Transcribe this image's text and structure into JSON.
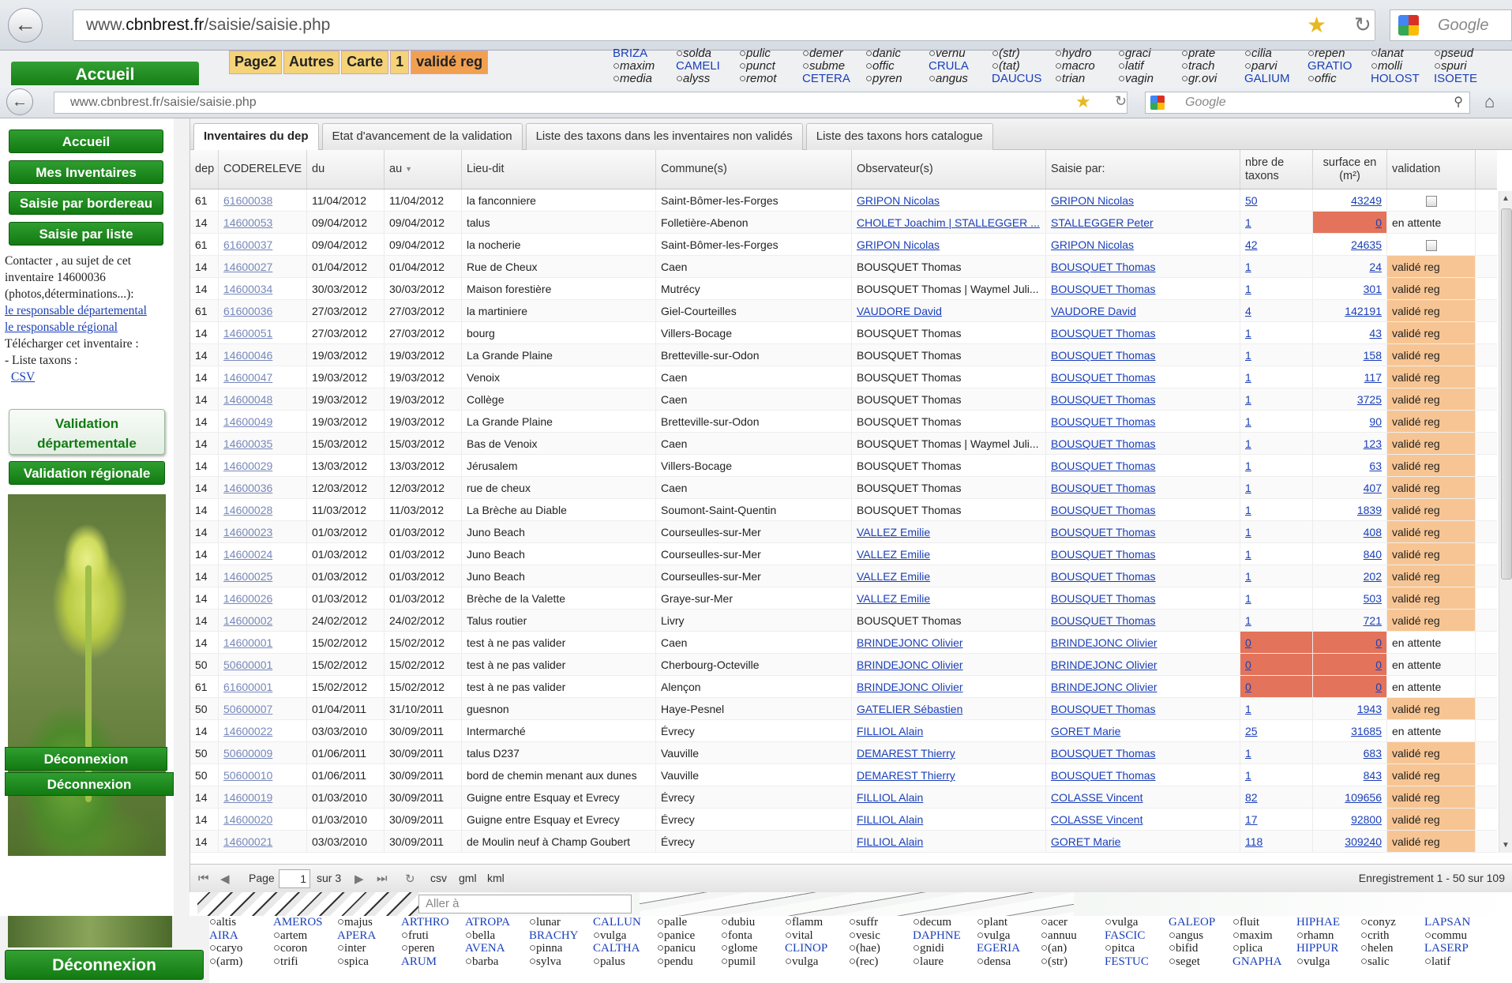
{
  "outer_browser": {
    "url_prefix": "www.",
    "url_domain": "cbnbrest.fr",
    "url_path": "/saisie/saisie.php",
    "search_placeholder": "Google",
    "accueil_label": "Accueil",
    "tabs": [
      "Page2",
      "Autres",
      "Carte",
      "1",
      "validé reg"
    ],
    "taxa_rows": [
      [
        "BRIZA",
        "○solda",
        "○pulic",
        "○demer",
        "○danic",
        "○vernu",
        "○(str)",
        "○hydro",
        "○graci",
        "○prate",
        "○cilia",
        "○repen",
        "○lanat",
        "○pseud"
      ],
      [
        "○maxim",
        "CAMELI",
        "○punct",
        "○subme",
        "○offic",
        "CRULA",
        "○(tat)",
        "○macro",
        "○latif",
        "○trach",
        "○parvi",
        "GRATIO",
        "○molli",
        "○spuri"
      ],
      [
        "○media",
        "○alyss",
        "○remot",
        "CETERA",
        "○pyren",
        "○angus",
        "DAUCUS",
        "○trian",
        "○vagin",
        "○gr.ovi",
        "GALIUM",
        "○offic",
        "HOLOST",
        "ISOETE"
      ]
    ]
  },
  "inner_browser": {
    "url": "www.cbnbrest.fr/saisie/saisie.php",
    "search_placeholder": "Google"
  },
  "sidebar": {
    "buttons": [
      "Accueil",
      "Mes Inventaires",
      "Saisie par bordereau",
      "Saisie par liste"
    ],
    "contact_text": "Contacter , au sujet de cet inventaire 14600036 (photos,déterminations...):",
    "link_dep": "le responsable départemental",
    "link_reg": "le responsable régional",
    "download_text": "Télécharger cet inventaire :",
    "taxa_list_text": "- Liste taxons :",
    "csv_link": "CSV",
    "validation_dep": "Validation départementale",
    "validation_reg": "Validation régionale",
    "logout": "Déconnexion"
  },
  "tabs": [
    "Inventaires du dep",
    "Etat d'avancement de la validation",
    "Liste des taxons dans les inventaires non validés",
    "Liste des taxons hors catalogue"
  ],
  "grid": {
    "headers": {
      "dep": "dep",
      "code": "CODERELEVE",
      "du": "du",
      "au": "au",
      "lieu": "Lieu-dit",
      "commune": "Commune(s)",
      "obs": "Observateur(s)",
      "saisie": "Saisie par:",
      "nb": "nbre de taxons",
      "surf": "surface en (m²)",
      "valid": "validation"
    },
    "rows": [
      {
        "dep": "61",
        "code": "61600038",
        "du": "11/04/2012",
        "au": "11/04/2012",
        "lieu": "la fanconniere",
        "commune": "Saint-Bômer-les-Forges",
        "obs": "GRIPON Nicolas",
        "obs_link": true,
        "saisie": "GRIPON Nicolas",
        "nb": "50",
        "surf": "43249",
        "valid": "",
        "state": "check"
      },
      {
        "dep": "14",
        "code": "14600053",
        "du": "09/04/2012",
        "au": "09/04/2012",
        "lieu": "talus",
        "commune": "Folletière-Abenon",
        "obs": "CHOLET Joachim | STALLEGGER ...",
        "obs_link": true,
        "saisie": "STALLEGGER Peter",
        "nb": "1",
        "surf": "0",
        "valid": "en attente",
        "state": "wait-surf"
      },
      {
        "dep": "61",
        "code": "61600037",
        "du": "09/04/2012",
        "au": "09/04/2012",
        "lieu": "la nocherie",
        "commune": "Saint-Bômer-les-Forges",
        "obs": "GRIPON Nicolas",
        "obs_link": true,
        "saisie": "GRIPON Nicolas",
        "nb": "42",
        "surf": "24635",
        "valid": "",
        "state": "check"
      },
      {
        "dep": "14",
        "code": "14600027",
        "du": "01/04/2012",
        "au": "01/04/2012",
        "lieu": "Rue de Cheux",
        "commune": "Caen",
        "obs": "BOUSQUET Thomas",
        "obs_link": false,
        "saisie": "BOUSQUET Thomas",
        "nb": "1",
        "surf": "24",
        "valid": "validé reg",
        "state": "valid"
      },
      {
        "dep": "14",
        "code": "14600034",
        "du": "30/03/2012",
        "au": "30/03/2012",
        "lieu": "Maison forestière",
        "commune": "Mutrécy",
        "obs": "BOUSQUET Thomas | Waymel Juli...",
        "obs_link": false,
        "saisie": "BOUSQUET Thomas",
        "nb": "1",
        "surf": "301",
        "valid": "validé reg",
        "state": "valid"
      },
      {
        "dep": "61",
        "code": "61600036",
        "du": "27/03/2012",
        "au": "27/03/2012",
        "lieu": "la martiniere",
        "commune": "Giel-Courteilles",
        "obs": "VAUDORE David",
        "obs_link": true,
        "saisie": "VAUDORE David",
        "nb": "4",
        "surf": "142191",
        "valid": "validé reg",
        "state": "valid"
      },
      {
        "dep": "14",
        "code": "14600051",
        "du": "27/03/2012",
        "au": "27/03/2012",
        "lieu": "bourg",
        "commune": "Villers-Bocage",
        "obs": "BOUSQUET Thomas",
        "obs_link": false,
        "saisie": "BOUSQUET Thomas",
        "nb": "1",
        "surf": "43",
        "valid": "validé reg",
        "state": "valid"
      },
      {
        "dep": "14",
        "code": "14600046",
        "du": "19/03/2012",
        "au": "19/03/2012",
        "lieu": "La Grande Plaine",
        "commune": "Bretteville-sur-Odon",
        "obs": "BOUSQUET Thomas",
        "obs_link": false,
        "saisie": "BOUSQUET Thomas",
        "nb": "1",
        "surf": "158",
        "valid": "validé reg",
        "state": "valid"
      },
      {
        "dep": "14",
        "code": "14600047",
        "du": "19/03/2012",
        "au": "19/03/2012",
        "lieu": "Venoix",
        "commune": "Caen",
        "obs": "BOUSQUET Thomas",
        "obs_link": false,
        "saisie": "BOUSQUET Thomas",
        "nb": "1",
        "surf": "117",
        "valid": "validé reg",
        "state": "valid"
      },
      {
        "dep": "14",
        "code": "14600048",
        "du": "19/03/2012",
        "au": "19/03/2012",
        "lieu": "Collège",
        "commune": "Caen",
        "obs": "BOUSQUET Thomas",
        "obs_link": false,
        "saisie": "BOUSQUET Thomas",
        "nb": "1",
        "surf": "3725",
        "valid": "validé reg",
        "state": "valid"
      },
      {
        "dep": "14",
        "code": "14600049",
        "du": "19/03/2012",
        "au": "19/03/2012",
        "lieu": "La Grande Plaine",
        "commune": "Bretteville-sur-Odon",
        "obs": "BOUSQUET Thomas",
        "obs_link": false,
        "saisie": "BOUSQUET Thomas",
        "nb": "1",
        "surf": "90",
        "valid": "validé reg",
        "state": "valid"
      },
      {
        "dep": "14",
        "code": "14600035",
        "du": "15/03/2012",
        "au": "15/03/2012",
        "lieu": "Bas de Venoix",
        "commune": "Caen",
        "obs": "BOUSQUET Thomas | Waymel Juli...",
        "obs_link": false,
        "saisie": "BOUSQUET Thomas",
        "nb": "1",
        "surf": "123",
        "valid": "validé reg",
        "state": "valid"
      },
      {
        "dep": "14",
        "code": "14600029",
        "du": "13/03/2012",
        "au": "13/03/2012",
        "lieu": "Jérusalem",
        "commune": "Villers-Bocage",
        "obs": "BOUSQUET Thomas",
        "obs_link": false,
        "saisie": "BOUSQUET Thomas",
        "nb": "1",
        "surf": "63",
        "valid": "validé reg",
        "state": "valid"
      },
      {
        "dep": "14",
        "code": "14600036",
        "du": "12/03/2012",
        "au": "12/03/2012",
        "lieu": "rue de cheux",
        "commune": "Caen",
        "obs": "BOUSQUET Thomas",
        "obs_link": false,
        "saisie": "BOUSQUET Thomas",
        "nb": "1",
        "surf": "407",
        "valid": "validé reg",
        "state": "valid"
      },
      {
        "dep": "14",
        "code": "14600028",
        "du": "11/03/2012",
        "au": "11/03/2012",
        "lieu": "La Brèche au Diable",
        "commune": "Soumont-Saint-Quentin",
        "obs": "BOUSQUET Thomas",
        "obs_link": false,
        "saisie": "BOUSQUET Thomas",
        "nb": "1",
        "surf": "1839",
        "valid": "validé reg",
        "state": "valid"
      },
      {
        "dep": "14",
        "code": "14600023",
        "du": "01/03/2012",
        "au": "01/03/2012",
        "lieu": "Juno Beach",
        "commune": "Courseulles-sur-Mer",
        "obs": "VALLEZ Emilie",
        "obs_link": true,
        "saisie": "BOUSQUET Thomas",
        "nb": "1",
        "surf": "408",
        "valid": "validé reg",
        "state": "valid"
      },
      {
        "dep": "14",
        "code": "14600024",
        "du": "01/03/2012",
        "au": "01/03/2012",
        "lieu": "Juno Beach",
        "commune": "Courseulles-sur-Mer",
        "obs": "VALLEZ Emilie",
        "obs_link": true,
        "saisie": "BOUSQUET Thomas",
        "nb": "1",
        "surf": "840",
        "valid": "validé reg",
        "state": "valid"
      },
      {
        "dep": "14",
        "code": "14600025",
        "du": "01/03/2012",
        "au": "01/03/2012",
        "lieu": "Juno Beach",
        "commune": "Courseulles-sur-Mer",
        "obs": "VALLEZ Emilie",
        "obs_link": true,
        "saisie": "BOUSQUET Thomas",
        "nb": "1",
        "surf": "202",
        "valid": "validé reg",
        "state": "valid"
      },
      {
        "dep": "14",
        "code": "14600026",
        "du": "01/03/2012",
        "au": "01/03/2012",
        "lieu": "Brèche de la Valette",
        "commune": "Graye-sur-Mer",
        "obs": "VALLEZ Emilie",
        "obs_link": true,
        "saisie": "BOUSQUET Thomas",
        "nb": "1",
        "surf": "503",
        "valid": "validé reg",
        "state": "valid"
      },
      {
        "dep": "14",
        "code": "14600002",
        "du": "24/02/2012",
        "au": "24/02/2012",
        "lieu": "Talus routier",
        "commune": "Livry",
        "obs": "BOUSQUET Thomas",
        "obs_link": false,
        "saisie": "BOUSQUET Thomas",
        "nb": "1",
        "surf": "721",
        "valid": "validé reg",
        "state": "valid"
      },
      {
        "dep": "14",
        "code": "14600001",
        "du": "15/02/2012",
        "au": "15/02/2012",
        "lieu": "test à ne pas valider",
        "commune": "Caen",
        "obs": "BRINDEJONC Olivier",
        "obs_link": true,
        "saisie": "BRINDEJONC Olivier",
        "nb": "0",
        "surf": "0",
        "valid": "en attente",
        "state": "wait-both"
      },
      {
        "dep": "50",
        "code": "50600001",
        "du": "15/02/2012",
        "au": "15/02/2012",
        "lieu": "test à ne pas valider",
        "commune": "Cherbourg-Octeville",
        "obs": "BRINDEJONC Olivier",
        "obs_link": true,
        "saisie": "BRINDEJONC Olivier",
        "nb": "0",
        "surf": "0",
        "valid": "en attente",
        "state": "wait-both"
      },
      {
        "dep": "61",
        "code": "61600001",
        "du": "15/02/2012",
        "au": "15/02/2012",
        "lieu": "test à ne pas valider",
        "commune": "Alençon",
        "obs": "BRINDEJONC Olivier",
        "obs_link": true,
        "saisie": "BRINDEJONC Olivier",
        "nb": "0",
        "surf": "0",
        "valid": "en attente",
        "state": "wait-both"
      },
      {
        "dep": "50",
        "code": "50600007",
        "du": "01/04/2011",
        "au": "31/10/2011",
        "lieu": "guesnon",
        "commune": "Haye-Pesnel",
        "obs": "GATELIER Sébastien",
        "obs_link": true,
        "saisie": "BOUSQUET Thomas",
        "nb": "1",
        "surf": "1943",
        "valid": "validé reg",
        "state": "valid"
      },
      {
        "dep": "14",
        "code": "14600022",
        "du": "03/03/2010",
        "au": "30/09/2011",
        "lieu": "Intermarché",
        "commune": "Évrecy",
        "obs": "FILLIOL Alain",
        "obs_link": true,
        "saisie": "GORET Marie",
        "nb": "25",
        "surf": "31685",
        "valid": "en attente",
        "state": "plain"
      },
      {
        "dep": "50",
        "code": "50600009",
        "du": "01/06/2011",
        "au": "30/09/2011",
        "lieu": "talus D237",
        "commune": "Vauville",
        "obs": "DEMAREST Thierry",
        "obs_link": true,
        "saisie": "BOUSQUET Thomas",
        "nb": "1",
        "surf": "683",
        "valid": "validé reg",
        "state": "valid"
      },
      {
        "dep": "50",
        "code": "50600010",
        "du": "01/06/2011",
        "au": "30/09/2011",
        "lieu": "bord de chemin menant aux dunes",
        "commune": "Vauville",
        "obs": "DEMAREST Thierry",
        "obs_link": true,
        "saisie": "BOUSQUET Thomas",
        "nb": "1",
        "surf": "843",
        "valid": "validé reg",
        "state": "valid"
      },
      {
        "dep": "14",
        "code": "14600019",
        "du": "01/03/2010",
        "au": "30/09/2011",
        "lieu": "Guigne entre Esquay et Evrecy",
        "commune": "Évrecy",
        "obs": "FILLIOL Alain",
        "obs_link": true,
        "saisie": "COLASSE Vincent",
        "nb": "82",
        "surf": "109656",
        "valid": "validé reg",
        "state": "valid"
      },
      {
        "dep": "14",
        "code": "14600020",
        "du": "01/03/2010",
        "au": "30/09/2011",
        "lieu": "Guigne entre Esquay et Evrecy",
        "commune": "Évrecy",
        "obs": "FILLIOL Alain",
        "obs_link": true,
        "saisie": "COLASSE Vincent",
        "nb": "17",
        "surf": "92800",
        "valid": "validé reg",
        "state": "valid"
      },
      {
        "dep": "14",
        "code": "14600021",
        "du": "03/03/2010",
        "au": "30/09/2011",
        "lieu": "de Moulin neuf à Champ Goubert",
        "commune": "Évrecy",
        "obs": "FILLIOL Alain",
        "obs_link": true,
        "saisie": "GORET Marie",
        "nb": "118",
        "surf": "309240",
        "valid": "validé reg",
        "state": "valid"
      }
    ]
  },
  "pager": {
    "page_label": "Page",
    "page_value": "1",
    "of_label": "sur 3",
    "export_csv": "csv",
    "export_gml": "gml",
    "export_kml": "kml",
    "records": "Enregistrement 1 - 50 sur 109"
  },
  "ghost": {
    "aller_placeholder": "Aller à",
    "taxa_rows": [
      [
        "○altis",
        "AMEROS",
        "○majus",
        "ARTHRO",
        "ATROPA",
        "○lunar",
        "CALLUN",
        "○palle",
        "○dubiu",
        "○flamm",
        "○suffr",
        "○decum",
        "○plant",
        "○acer",
        "○vulga",
        "GALEOP",
        "○fluit",
        "HIPHAE",
        "○conyz",
        "LAPSAN"
      ],
      [
        "AIRA",
        "○artem",
        "APERA",
        "○fruti",
        "○bella",
        "BRACHY",
        "○vulga",
        "○panice",
        "○fonta",
        "○vital",
        "○vesic",
        "DAPHNE",
        "○vulga",
        "○annuu",
        "FASCIC",
        "○angus",
        "○maxim",
        "○rhamn",
        "○crith",
        "○commu"
      ],
      [
        "○caryo",
        "○coron",
        "○inter",
        "○peren",
        "AVENA",
        "○pinna",
        "CALTHA",
        "○panicu",
        "○glome",
        "CLINOP",
        "○(hae)",
        "○gnidi",
        "EGERIA",
        "○(an)",
        "○pitca",
        "○bifid",
        "○plica",
        "HIPPUR",
        "○helen",
        "LASERP"
      ],
      [
        "○(arm)",
        "○trifi",
        "○spica",
        "ARUM",
        "○barba",
        "○sylva",
        "○palus",
        "○pendu",
        "○pumil",
        "○vulga",
        "○(rec)",
        "○laure",
        "○densa",
        "○(str)",
        "FESTUC",
        "○seget",
        "GNAPHA",
        "○vulga",
        "○salic",
        "○latif"
      ]
    ]
  }
}
